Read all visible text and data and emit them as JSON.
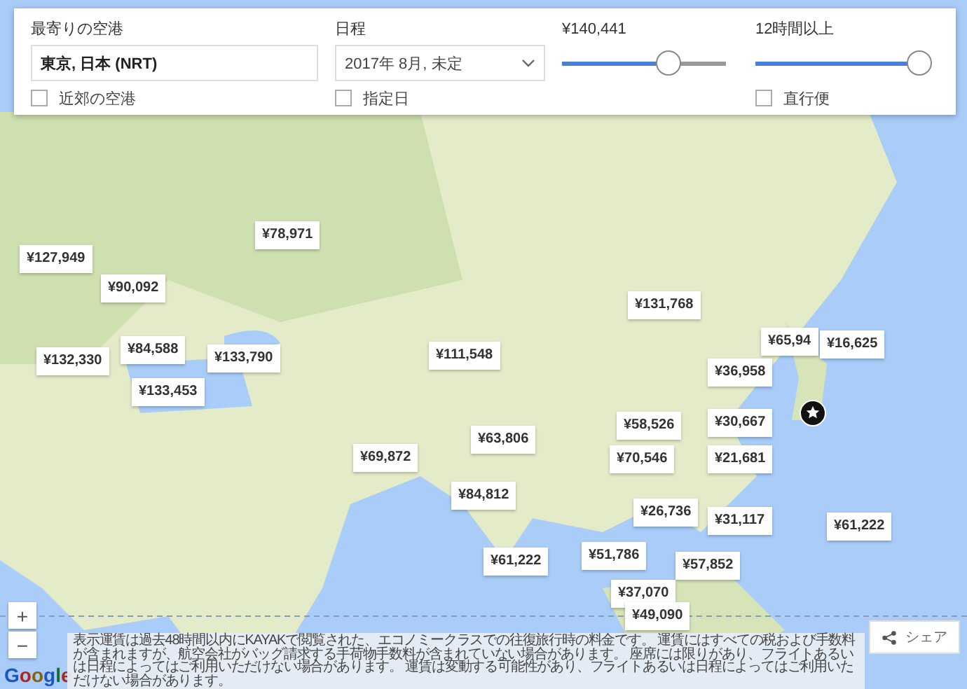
{
  "filters": {
    "origin": {
      "label": "最寄りの空港",
      "value": "東京, 日本 (NRT)",
      "nearby": {
        "label": "近郊の空港",
        "checked": false
      }
    },
    "dates": {
      "label": "日程",
      "value": "2017年 8月, 未定",
      "exact": {
        "label": "指定日",
        "checked": false
      }
    },
    "price": {
      "label": "¥140,441",
      "level": 0.62
    },
    "duration": {
      "label": "12時間以上",
      "level": 1,
      "nonstop": {
        "label": "直行便",
        "checked": false
      }
    }
  },
  "map": {
    "pins": [
      {
        "price": "¥127,949"
      },
      {
        "price": "¥78,971"
      },
      {
        "price": "¥90,092"
      },
      {
        "price": "¥84,588"
      },
      {
        "price": "¥132,330"
      },
      {
        "price": "¥133,790"
      },
      {
        "price": "¥133,453"
      },
      {
        "price": "¥111,548"
      },
      {
        "price": "¥131,768"
      },
      {
        "price": "¥65,94"
      },
      {
        "price": "¥16,625"
      },
      {
        "price": "¥36,958"
      },
      {
        "price": "¥58,526"
      },
      {
        "price": "¥30,667"
      },
      {
        "price": "¥63,806"
      },
      {
        "price": "¥69,872"
      },
      {
        "price": "¥70,546"
      },
      {
        "price": "¥21,681"
      },
      {
        "price": "¥84,812"
      },
      {
        "price": "¥26,736"
      },
      {
        "price": "¥31,117"
      },
      {
        "price": "¥61,222"
      },
      {
        "price": "¥61,222"
      },
      {
        "price": "¥51,786"
      },
      {
        "price": "¥57,852"
      },
      {
        "price": "¥37,070"
      },
      {
        "price": "¥49,090"
      }
    ],
    "zoom_in": "+",
    "zoom_out": "−",
    "logo": "Google",
    "share": "シェア",
    "disclaimer": "表示運賃は過去48時間以内にKAYAKで閲覧された、エコノミークラスでの往復旅行時の料金です。 運賃にはすべての税および手数料が含まれますが、航空会社がバッグ請求する手荷物手数料が含まれていない場合があります。 座席には限りがあり、フライトあるいは日程によってはご利用いただけない場合があります。 運賃は変動する可能性があり、フライトあるいは日程によってはご利用いただけない場合があります。"
  }
}
